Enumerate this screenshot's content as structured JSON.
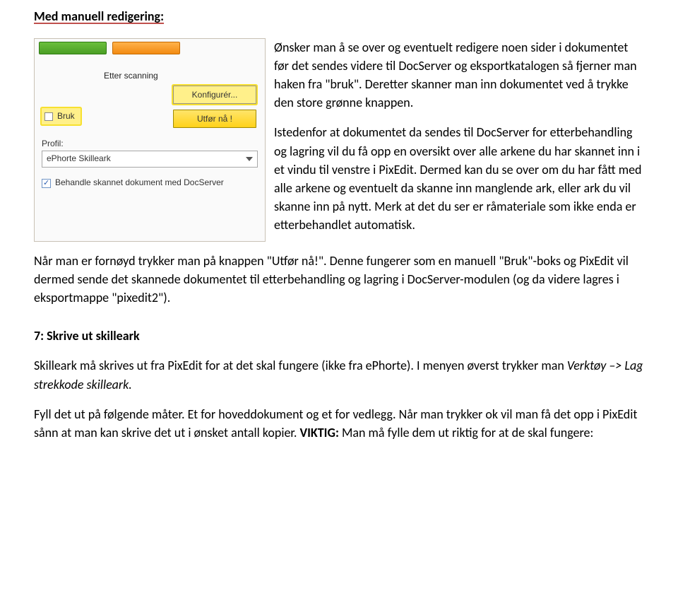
{
  "doc": {
    "heading1": "Med manuell redigering:",
    "para1": "Ønsker man å se over og eventuelt redigere noen sider i dokumentet før det sendes videre til DocServer og eksportkatalogen så fjerner man haken fra \"bruk\". Deretter skanner man inn dokumentet ved å trykke den store grønne knappen.",
    "para2": "Istedenfor at dokumentet da sendes til DocServer for etterbehandling og lagring vil du få opp en oversikt over alle arkene du har skannet inn i et vindu til venstre i PixEdit. Dermed kan du se over om du har fått med alle arkene og eventuelt da skanne inn manglende ark, eller ark du vil skanne inn på nytt. Merk at det du ser er råmateriale som ikke enda er etterbehandlet automatisk.",
    "para3": "Når man er fornøyd trykker man på knappen \"Utfør nå!\". Denne fungerer som en manuell \"Bruk\"-boks og PixEdit vil dermed sende det skannede dokumentet til etterbehandling og lagring i DocServer-modulen (og da videre lagres i eksportmappe \"pixedit2\").",
    "heading2": "7: Skrive ut skilleark",
    "para4a": "Skilleark må skrives ut fra PixEdit for at det skal fungere (ikke fra ePhorte). I menyen øverst trykker man ",
    "para4b": "Verktøy –> Lag strekkode skilleark.",
    "para5a": "Fyll det ut på følgende måter. Et for hoveddokument og et for vedlegg. Når man trykker ok vil man få det opp i PixEdit sånn at man kan skrive det ut i ønsket antall kopier. ",
    "para5bold": "VIKTIG:",
    "para5b": " Man må fylle dem ut riktig for at de skal fungere:"
  },
  "ui": {
    "etter_scanning": "Etter scanning",
    "btn_konfigurer": "Konfigurér...",
    "btn_utfor": "Utfør nå !",
    "bruk": "Bruk",
    "profil_label": "Profil:",
    "profil_value": "ePhorte Skilleark",
    "behandle_text": "Behandle skannet dokument med DocServer"
  }
}
